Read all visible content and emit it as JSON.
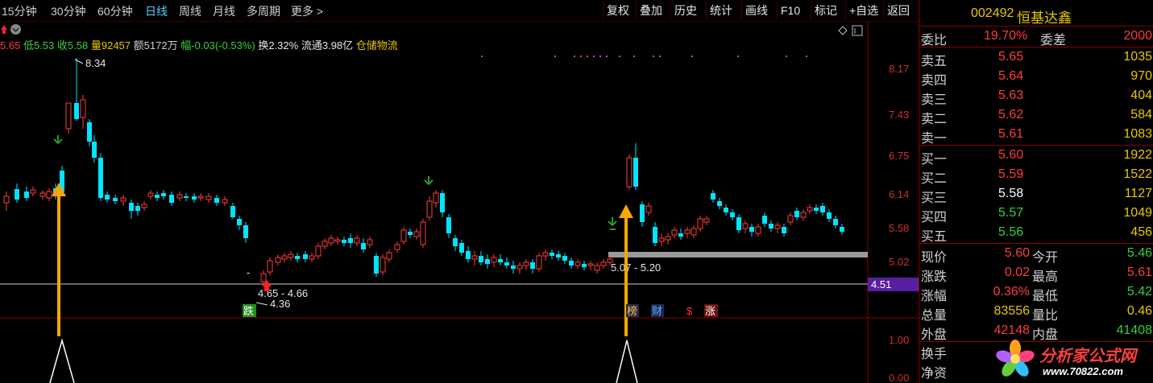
{
  "toolbar": {
    "periods": [
      "15分钟",
      "30分钟",
      "60分钟",
      "日线",
      "周线",
      "月线",
      "多周期",
      "更多"
    ],
    "buttons": [
      "复权",
      "叠加",
      "历史",
      "统计",
      "画线",
      "F10",
      "标记",
      "+自选",
      "返回"
    ]
  },
  "info_bar": {
    "high": "5.65",
    "low_label": "低",
    "low": "5.53",
    "close_label": "收",
    "close": "5.58",
    "vol_label": "量",
    "vol": "92457",
    "amount_label": "额",
    "amount": "5172万",
    "change_label": "幅",
    "change": "-0.03(-0.53%)",
    "turnover_label": "换",
    "turnover": "2.32%",
    "float_label": "流通",
    "float": "3.98亿",
    "sector": "仓储物流"
  },
  "chart": {
    "y_ticks": [
      "8.17",
      "7.43",
      "6.75",
      "6.14",
      "5.58",
      "5.02",
      "4.51"
    ],
    "current_price_tag": "4.51",
    "sub_ticks": [
      "1.00",
      "0.00"
    ],
    "annotations": {
      "high_label": "8.34",
      "low_label": "4.36",
      "low_range": "4.65 - 4.66",
      "mid_range": "5.07 - 5.20"
    },
    "markers": [
      "跌",
      "榜",
      "财",
      "$",
      "涨"
    ]
  },
  "quote": {
    "code": "002492",
    "name": "恒基达鑫",
    "weibi_label": "委比",
    "weibi": "19.70%",
    "weicha_label": "委差",
    "weicha": "2000",
    "asks": [
      {
        "label": "卖五",
        "price": "5.65",
        "vol": "1035"
      },
      {
        "label": "卖四",
        "price": "5.64",
        "vol": "970"
      },
      {
        "label": "卖三",
        "price": "5.63",
        "vol": "404"
      },
      {
        "label": "卖二",
        "price": "5.62",
        "vol": "584"
      },
      {
        "label": "卖一",
        "price": "5.61",
        "vol": "1083"
      }
    ],
    "bids": [
      {
        "label": "买一",
        "price": "5.60",
        "vol": "1922"
      },
      {
        "label": "买二",
        "price": "5.59",
        "vol": "1522"
      },
      {
        "label": "买三",
        "price": "5.58",
        "vol": "1127"
      },
      {
        "label": "买四",
        "price": "5.57",
        "vol": "1049"
      },
      {
        "label": "买五",
        "price": "5.56",
        "vol": "456"
      }
    ],
    "stats": [
      {
        "l1": "现价",
        "v1": "5.60",
        "l2": "今开",
        "v2": "5.46"
      },
      {
        "l1": "涨跌",
        "v1": "0.02",
        "l2": "最高",
        "v2": "5.61"
      },
      {
        "l1": "涨幅",
        "v1": "0.36%",
        "l2": "最低",
        "v2": "5.42"
      },
      {
        "l1": "总量",
        "v1": "83556",
        "l2": "量比",
        "v2": "0.46"
      },
      {
        "l1": "外盘",
        "v1": "42148",
        "l2": "内盘",
        "v2": "41408"
      }
    ],
    "extra": [
      "换手",
      "净资"
    ]
  },
  "watermark": {
    "title": "分析家公式网",
    "url": "www.70822.com"
  },
  "colors": {
    "up": "#ff3c3c",
    "down": "#00e5ff",
    "green": "#35d03a",
    "yellow": "#e6c800",
    "grid": "#8a0000",
    "arrow": "#f5a800"
  }
}
